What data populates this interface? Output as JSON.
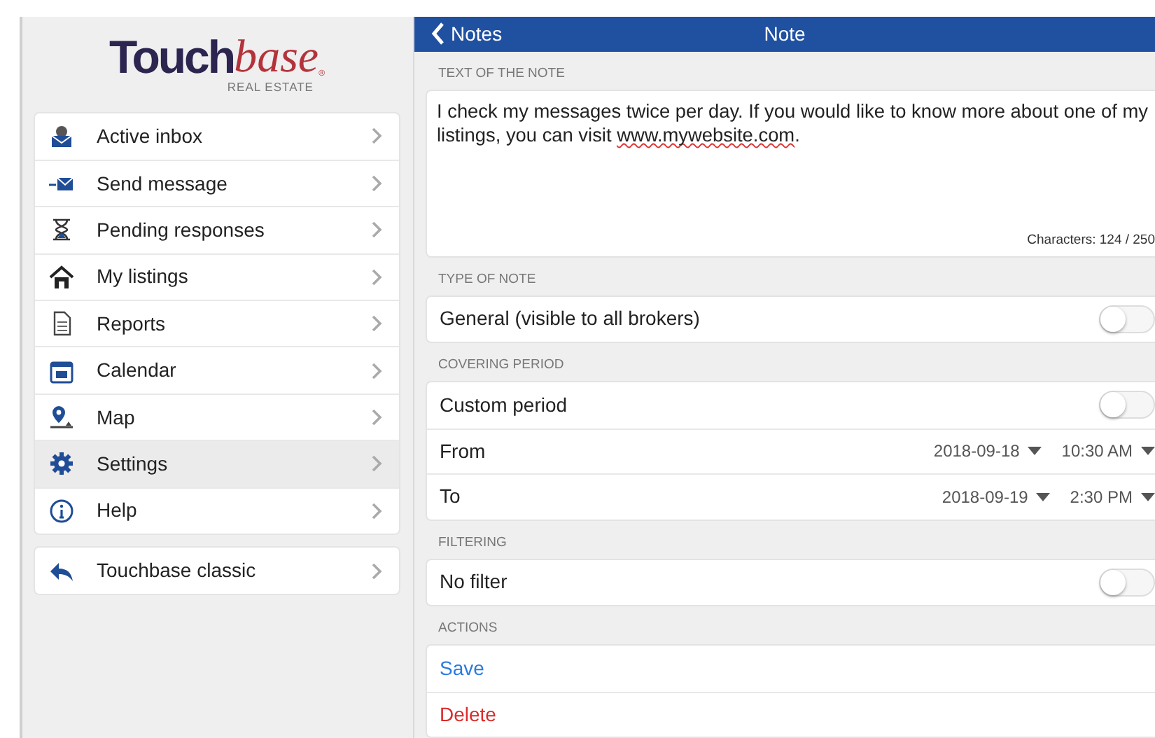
{
  "logo": {
    "main": "Touch",
    "accent": "base",
    "mark": "®",
    "tagline": "REAL ESTATE"
  },
  "sidebar": {
    "groups": [
      {
        "items": [
          {
            "label": "Active inbox",
            "selected": false
          },
          {
            "label": "Send message",
            "selected": false
          },
          {
            "label": "Pending responses",
            "selected": false
          },
          {
            "label": "My listings",
            "selected": false
          },
          {
            "label": "Reports",
            "selected": false
          },
          {
            "label": "Calendar",
            "selected": false
          },
          {
            "label": "Map",
            "selected": false
          },
          {
            "label": "Settings",
            "selected": true
          },
          {
            "label": "Help",
            "selected": false
          }
        ]
      },
      {
        "items": [
          {
            "label": "Touchbase classic",
            "selected": false
          }
        ]
      }
    ]
  },
  "header": {
    "back": "Notes",
    "title": "Note"
  },
  "sections": [
    {
      "label": "TEXT OF THE NOTE",
      "kind": "note",
      "segments": [
        {
          "text": "I check my messages twice per day. If you would like to know more about one of my listings, you can visit ",
          "flagged": false
        },
        {
          "text": "www.mywebsite.com",
          "flagged": true
        },
        {
          "text": ".",
          "flagged": false
        }
      ],
      "counter": "Characters: 124 / 250"
    },
    {
      "label": "TYPE OF NOTE",
      "kind": "rows",
      "rows": [
        {
          "kind": "toggle",
          "label": "General (visible to all brokers)",
          "on": false
        }
      ]
    },
    {
      "label": "COVERING PERIOD",
      "kind": "rows",
      "rows": [
        {
          "kind": "toggle",
          "label": "Custom period",
          "on": false
        },
        {
          "kind": "datetime",
          "label": "From",
          "date": "2018-09-18",
          "time": "10:30 AM"
        },
        {
          "kind": "datetime",
          "label": "To",
          "date": "2018-09-19",
          "time": "2:30 PM"
        }
      ]
    },
    {
      "label": "FILTERING",
      "kind": "rows",
      "rows": [
        {
          "kind": "toggle",
          "label": "No filter",
          "on": false
        }
      ]
    },
    {
      "label": "ACTIONS",
      "kind": "rows",
      "rows": [
        {
          "kind": "action",
          "label": "Save",
          "color": "#2a7be0"
        },
        {
          "kind": "action",
          "label": "Delete",
          "color": "#dd2a2a"
        }
      ]
    }
  ]
}
